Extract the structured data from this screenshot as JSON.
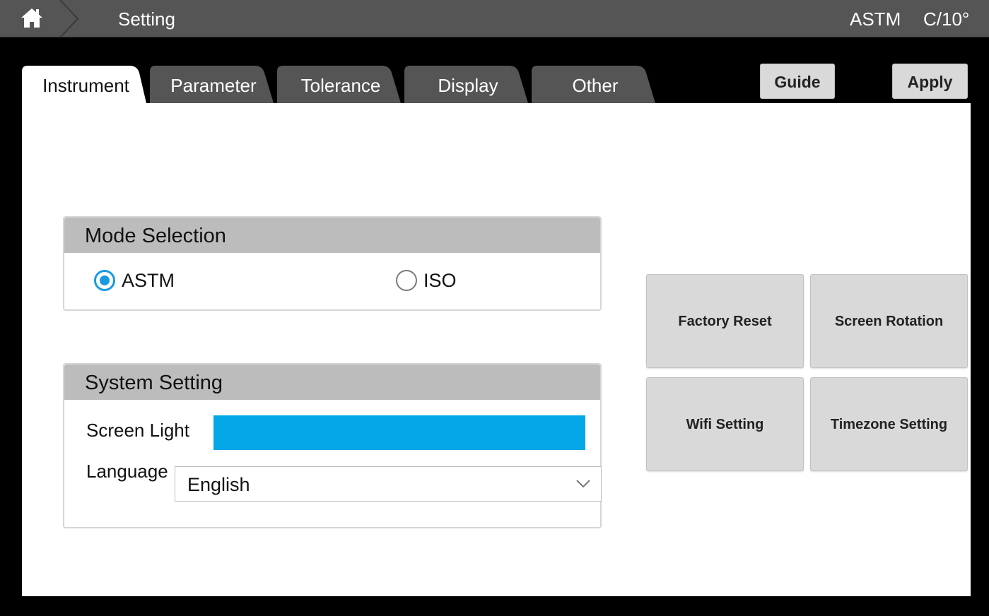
{
  "header": {
    "title": "Setting",
    "mode": "ASTM",
    "observer": "C/10°",
    "home_icon": "home-icon"
  },
  "tabs": [
    {
      "label": "Instrument",
      "active": true
    },
    {
      "label": "Parameter",
      "active": false
    },
    {
      "label": "Tolerance",
      "active": false
    },
    {
      "label": "Display",
      "active": false
    },
    {
      "label": "Other",
      "active": false
    }
  ],
  "actions": {
    "guide_label": "Guide",
    "apply_label": "Apply"
  },
  "mode_selection": {
    "title": "Mode Selection",
    "options": [
      {
        "label": "ASTM",
        "selected": true
      },
      {
        "label": "ISO",
        "selected": false
      }
    ]
  },
  "system_setting": {
    "title": "System Setting",
    "screen_light_label": "Screen Light",
    "screen_light_level": 1.0,
    "language_label": "Language",
    "language_value": "English"
  },
  "function_buttons": {
    "factory_reset": "Factory Reset",
    "screen_rotation": "Screen Rotation",
    "wifi_setting": "Wifi Setting",
    "timezone_setting": "Timezone Setting"
  },
  "colors": {
    "topbar": "#555555",
    "tab_inactive": "#555555",
    "accent": "#05a6e8",
    "radio_accent": "#1a9be0",
    "button_gray": "#d9d9d9",
    "group_header": "#bcbcbc"
  }
}
